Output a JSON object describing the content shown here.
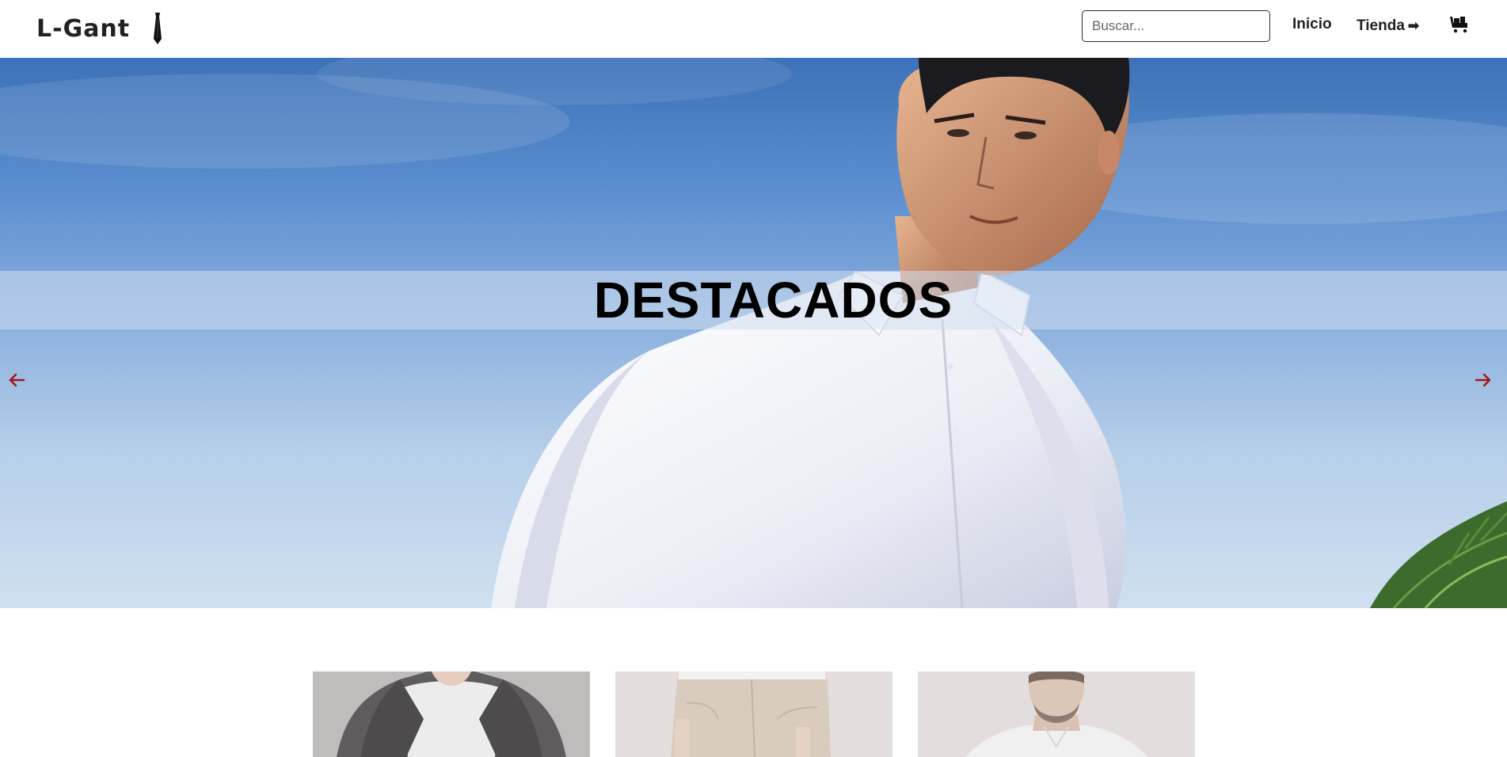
{
  "header": {
    "brand": "L-Gant",
    "brand_icon": "necktie-icon",
    "search": {
      "placeholder": "Buscar...",
      "value": ""
    },
    "nav": [
      {
        "label": "Inicio"
      },
      {
        "label": "Tienda",
        "icon": "right-arrow-icon",
        "icon_glyph": "➡"
      }
    ],
    "cart_icon": "cart-icon"
  },
  "hero": {
    "title": "DESTACADOS",
    "prev_icon": "arrow-left-icon",
    "next_icon": "arrow-right-icon",
    "arrow_color": "#a4151a"
  },
  "products": [
    {
      "image": "man-in-dark-blazer-white-tee"
    },
    {
      "image": "beige-trousers"
    },
    {
      "image": "man-in-white-shirt"
    }
  ],
  "colors": {
    "text": "#222222",
    "sky": "#5d8fd0",
    "accent": "#a4151a",
    "card_bg": "#e3dedd"
  }
}
